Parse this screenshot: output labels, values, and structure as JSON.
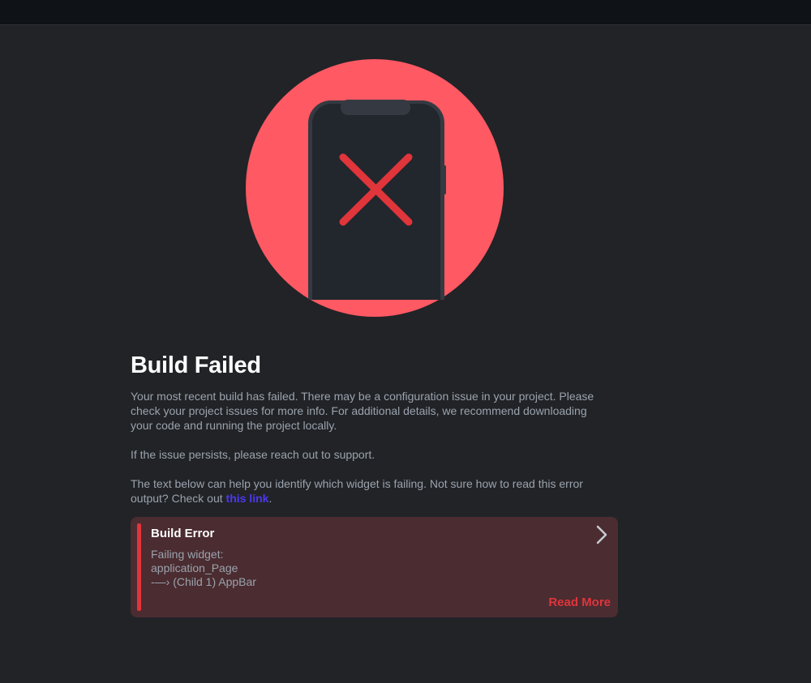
{
  "colors": {
    "background": "#212327",
    "topbar": "#0f1216",
    "illustration_circle": "#ff5963",
    "phone_body": "#22262d",
    "error_red": "#e0353b",
    "card_background": "#4a2c31",
    "link": "#4b39ef",
    "muted_text": "#9ba3ad"
  },
  "illustration": {
    "icon": "phone-error-icon",
    "mark": "x-mark-icon"
  },
  "main": {
    "title": "Build Failed",
    "paragraph1": "Your most recent build has failed. There may be a configuration issue in your project. Please check your project issues for more info. For additional details, we recommend downloading your code and running the project locally.",
    "paragraph2": "If the issue persists, please reach out to support.",
    "paragraph3_before_link": "The text below can help you identify which widget is failing. Not sure how to read this error output? Check out ",
    "paragraph3_link": "this link",
    "paragraph3_after_link": "."
  },
  "error_card": {
    "title": "Build Error",
    "lines": [
      "Failing widget:",
      "application_Page",
      "-—› (Child 1) AppBar"
    ],
    "read_more": "Read More",
    "expand_icon": "chevron-right-icon"
  }
}
